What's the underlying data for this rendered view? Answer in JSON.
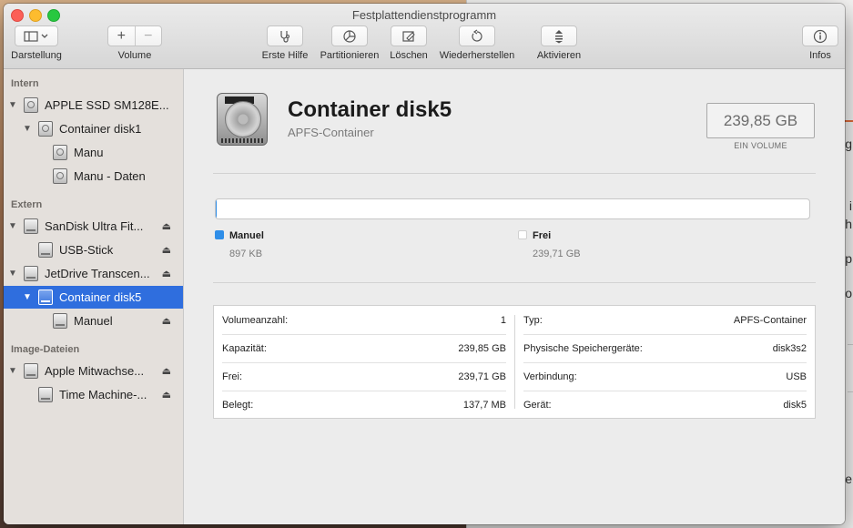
{
  "window": {
    "title": "Festplattendienstprogramm"
  },
  "toolbar": {
    "view_label": "Darstellung",
    "volume_label": "Volume",
    "volume_add": "+",
    "volume_remove": "−",
    "first_aid_label": "Erste Hilfe",
    "partition_label": "Partitionieren",
    "erase_label": "Löschen",
    "restore_label": "Wiederherstellen",
    "mount_label": "Aktivieren",
    "info_label": "Infos"
  },
  "sidebar": {
    "sections": [
      {
        "header": "Intern"
      },
      {
        "header": "Extern"
      },
      {
        "header": "Image-Dateien"
      }
    ],
    "items": [
      {
        "label": "APPLE SSD SM128E..."
      },
      {
        "label": "Container disk1"
      },
      {
        "label": "Manu"
      },
      {
        "label": "Manu - Daten"
      },
      {
        "label": "SanDisk Ultra Fit..."
      },
      {
        "label": "USB-Stick"
      },
      {
        "label": "JetDrive Transcen..."
      },
      {
        "label": "Container disk5"
      },
      {
        "label": "Manuel"
      },
      {
        "label": "Apple Mitwachse..."
      },
      {
        "label": "Time Machine-..."
      }
    ],
    "disclosure_open": "▼",
    "eject_glyph": "⏏"
  },
  "detail": {
    "title": "Container disk5",
    "subtitle": "APFS-Container",
    "size": "239,85 GB",
    "size_caption": "EIN VOLUME",
    "usage": {
      "used_fraction": 3.7e-06,
      "used_color": "#2f8ee8",
      "free_color": "#ffffff",
      "legend": [
        {
          "name": "Manuel",
          "value": "897 KB"
        },
        {
          "name": "Frei",
          "value": "239,71 GB"
        }
      ]
    },
    "info_left": [
      {
        "key": "Volumeanzahl:",
        "value": "1"
      },
      {
        "key": "Kapazität:",
        "value": "239,85 GB"
      },
      {
        "key": "Frei:",
        "value": "239,71 GB"
      },
      {
        "key": "Belegt:",
        "value": "137,7 MB"
      }
    ],
    "info_right": [
      {
        "key": "Typ:",
        "value": "APFS-Container"
      },
      {
        "key": "Physische Speichergeräte:",
        "value": "disk3s2"
      },
      {
        "key": "Verbindung:",
        "value": "USB"
      },
      {
        "key": "Gerät:",
        "value": "disk5"
      }
    ]
  },
  "background_app": {
    "letters": [
      "g",
      "i",
      "h",
      "p",
      "o",
      "e"
    ]
  },
  "colors": {
    "selection": "#2f6ede",
    "accent": "#2f8ee8"
  }
}
